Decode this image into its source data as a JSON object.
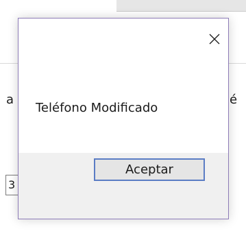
{
  "background": {
    "left_fragment": "a",
    "right_fragment": "é",
    "field_fragment": "3"
  },
  "dialog": {
    "message": "Teléfono Modificado",
    "accept_label": "Aceptar",
    "close_icon": "close-icon"
  }
}
